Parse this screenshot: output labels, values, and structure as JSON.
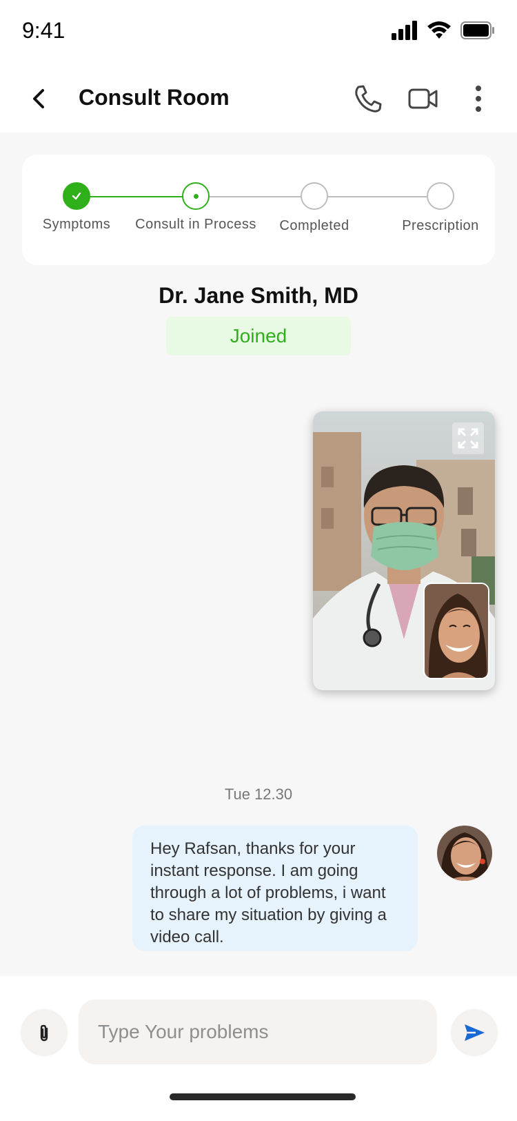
{
  "status_bar": {
    "time": "9:41"
  },
  "header": {
    "title": "Consult Room"
  },
  "progress": {
    "steps": [
      {
        "label": "Symptoms",
        "state": "done"
      },
      {
        "label": "Consult in Process",
        "state": "current"
      },
      {
        "label": "Completed",
        "state": "pending"
      },
      {
        "label": "Prescription",
        "state": "pending"
      }
    ]
  },
  "doctor": {
    "name": "Dr. Jane Smith, MD",
    "status": "Joined"
  },
  "chat": {
    "timestamp": "Tue 12.30",
    "message": "Hey Rafsan, thanks for your instant response. I am going through a lot of problems, i want to share my situation by giving a video call."
  },
  "composer": {
    "placeholder": "Type Your problems"
  },
  "colors": {
    "accent_green": "#2fb01a",
    "badge_bg": "#e8fae4",
    "bubble_bg": "#e6f2fc",
    "send_blue": "#1769d6"
  }
}
